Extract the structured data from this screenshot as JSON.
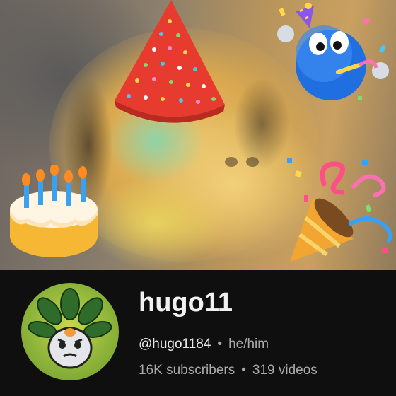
{
  "channel": {
    "name": "hugo11",
    "handle": "@hugo1184",
    "pronouns": "he/him",
    "subscribers": "16K subscribers",
    "videos": "319 videos",
    "separator": "•"
  },
  "banner": {
    "decorations": [
      "party-hat-icon",
      "party-emoji-icon",
      "birthday-cake-icon",
      "party-popper-icon"
    ]
  },
  "colors": {
    "background": "#0f0f0f",
    "title": "#f1f1f1",
    "secondary_text": "#aaaaaa"
  }
}
